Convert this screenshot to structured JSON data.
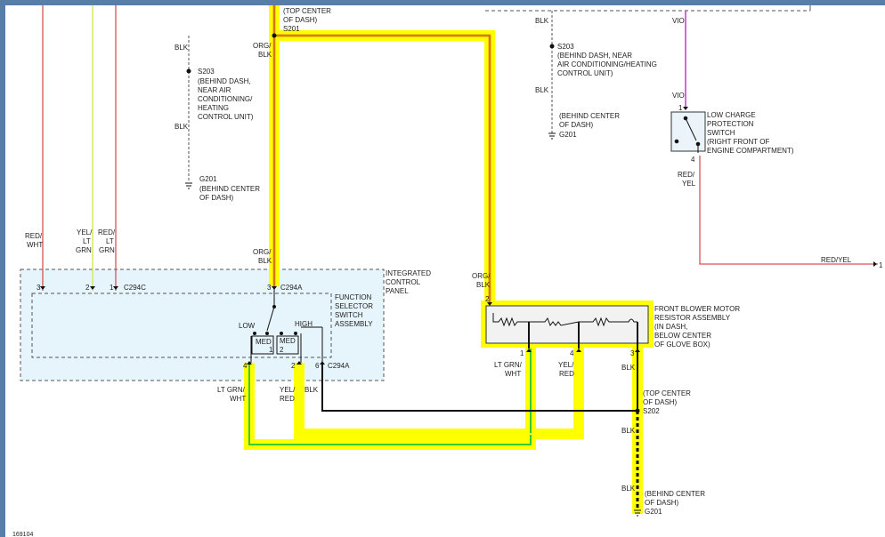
{
  "colors": {
    "frame_blue": "#5a7da8",
    "panel_fill": "#e6f4fb",
    "highlight_yellow": "#ffff00",
    "highlight_edge": "#e8a000",
    "wire_red": "#d9534f",
    "wire_lightgreen": "#cce84a",
    "wire_violet": "#cc33cc",
    "wire_orange": "#e8a000",
    "wire_green": "#33cc33",
    "wire_black": "#111111",
    "dashed_gray": "#555555"
  },
  "diagram_id": "169104",
  "left_splice": {
    "wire_top": "BLK",
    "id": "S203",
    "location": [
      "(BEHIND DASH,",
      "NEAR AIR",
      "CONDITIONING/",
      "HEATING",
      "CONTROL UNIT)"
    ],
    "wire_bottom": "BLK",
    "ground_id": "G201",
    "ground_location": [
      "(BEHIND CENTER",
      "OF DASH)"
    ]
  },
  "top_splice": {
    "location": [
      "(TOP CENTER",
      "OF DASH)"
    ],
    "id": "S201",
    "wire": [
      "ORG/",
      "BLK"
    ]
  },
  "middle_splice": {
    "wire_top": "BLK",
    "id": "S203",
    "location": [
      "(BEHIND DASH, NEAR",
      "AIR CONDITIONING/HEATING",
      "CONTROL UNIT)"
    ],
    "wire_bottom": "BLK",
    "ground_location": [
      "(BEHIND CENTER",
      "OF DASH)"
    ],
    "ground_id": "G201"
  },
  "low_charge_switch": {
    "wire_top": "VIO",
    "pin_top": "1",
    "pin_bottom": "4",
    "label": [
      "LOW CHARGE",
      "PROTECTION",
      "SWITCH",
      "(RIGHT FRONT OF",
      "ENGINE COMPARTMENT)"
    ],
    "wire_bottom": [
      "RED/",
      "YEL"
    ],
    "wire_exit": "RED/YEL",
    "exit_pin": "1"
  },
  "left_wires": {
    "w1": [
      "RED/",
      "WHT"
    ],
    "w2": [
      "YEL/",
      "LT",
      "GRN"
    ],
    "w3": [
      "RED/",
      "LT",
      "GRN"
    ]
  },
  "control_panel": {
    "label": [
      "INTEGRATED",
      "CONTROL",
      "PANEL"
    ],
    "connector_left": "C294C",
    "connector_mid": "C294A",
    "connector_bottom": "C294A",
    "pins_left": [
      "3",
      "2",
      "1"
    ],
    "pin_mid": "3",
    "org_blk": [
      "ORG/",
      "BLK"
    ],
    "switch_label": [
      "FUNCTION",
      "SELECTOR",
      "SWITCH",
      "ASSEMBLY"
    ],
    "positions": {
      "low": "LOW",
      "med1": "MED",
      "med1_n": "1",
      "med2": "MED",
      "med2_n": "2",
      "high": "HIGH"
    },
    "pins_bottom": [
      "4",
      "2",
      "6"
    ]
  },
  "bottom_wires": {
    "ltgrn": [
      "LT GRN/",
      "WHT"
    ],
    "yelred": [
      "YEL/",
      "RED"
    ],
    "blk": "BLK"
  },
  "resistor": {
    "wire_in": [
      "ORG/",
      "BLK"
    ],
    "pin_in": "2",
    "label": [
      "FRONT BLOWER MOTOR",
      "RESISTOR ASSEMBLY",
      "(IN DASH,",
      "BELOW CENTER",
      "OF GLOVE BOX)"
    ],
    "pins_bottom": [
      "1",
      "4",
      "3"
    ],
    "wire_ltgrn": [
      "LT GRN/",
      "WHT"
    ],
    "wire_yelred": [
      "YEL/",
      "RED"
    ],
    "wire_blk": "BLK"
  },
  "s202": {
    "location": [
      "(TOP CENTER",
      "OF DASH)"
    ],
    "id": "S202",
    "wire_below": "BLK",
    "wire_ground": "BLK",
    "ground_location": [
      "(BEHIND CENTER",
      "OF DASH)"
    ],
    "ground_id": "G201"
  }
}
